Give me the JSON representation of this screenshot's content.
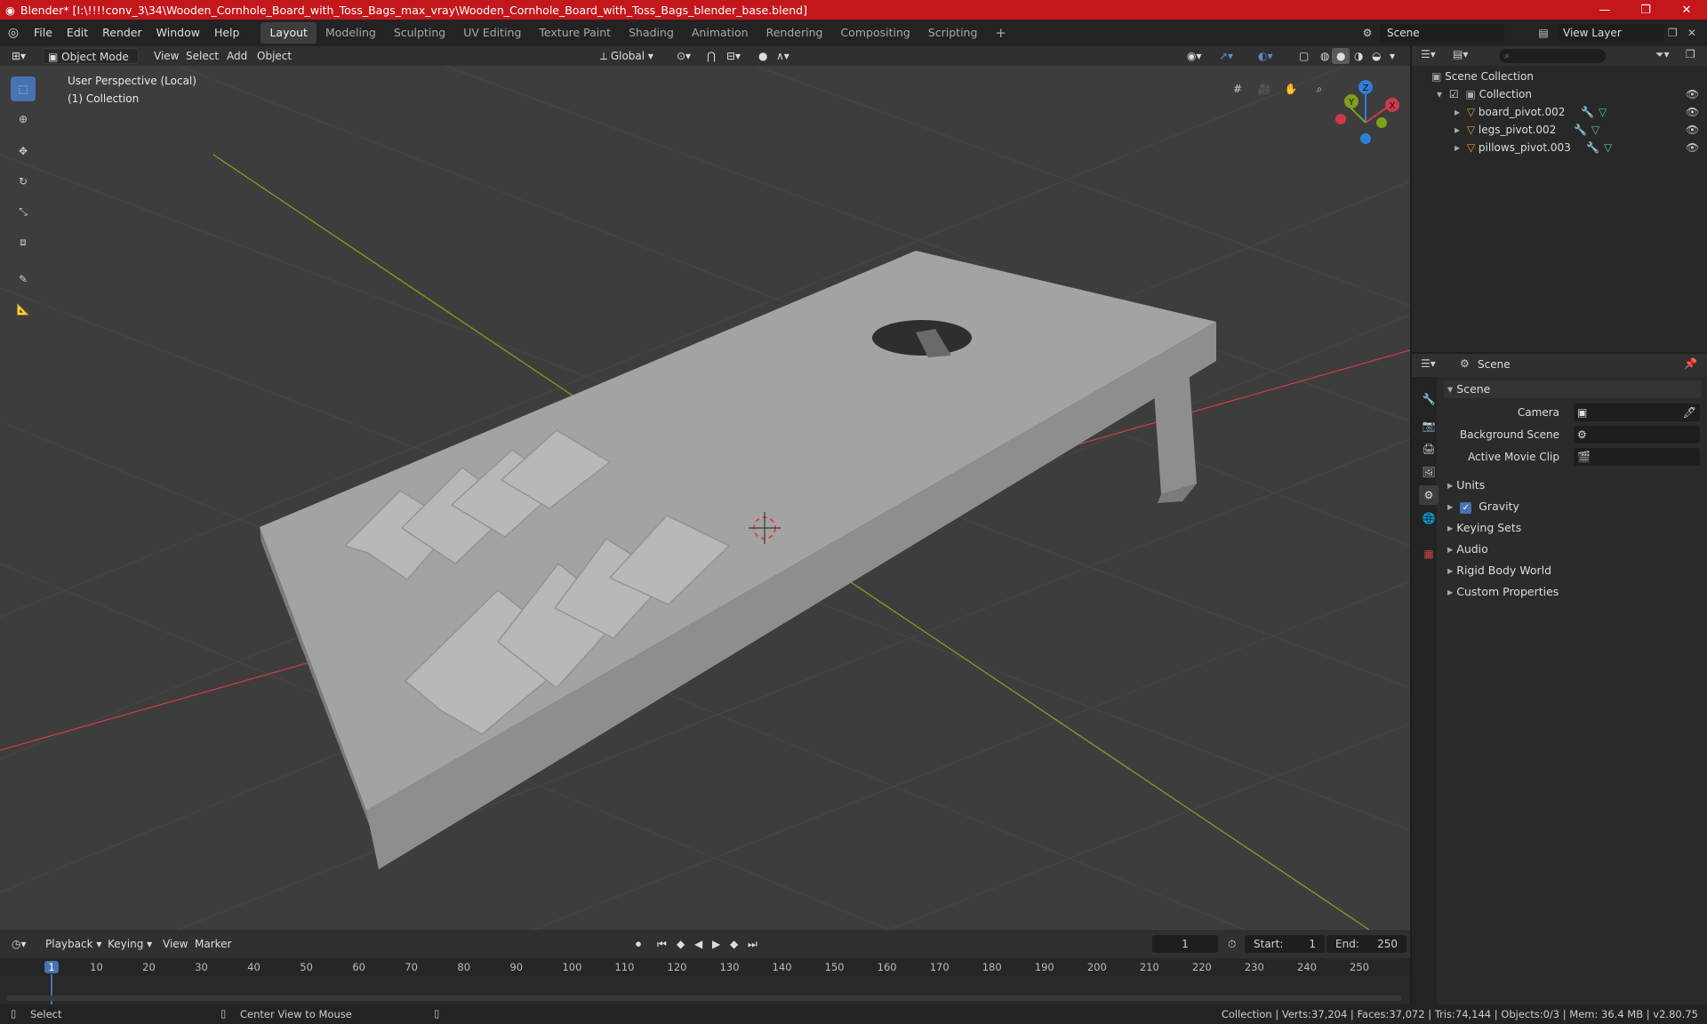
{
  "window": {
    "title": "Blender* [I:\\!!!!conv_3\\34\\Wooden_Cornhole_Board_with_Toss_Bags_max_vray\\Wooden_Cornhole_Board_with_Toss_Bags_blender_base.blend]",
    "minimize": "—",
    "maximize": "❐",
    "close": "✕"
  },
  "menu": [
    "File",
    "Edit",
    "Render",
    "Window",
    "Help"
  ],
  "workspaces": [
    "Layout",
    "Modeling",
    "Sculpting",
    "UV Editing",
    "Texture Paint",
    "Shading",
    "Animation",
    "Rendering",
    "Compositing",
    "Scripting"
  ],
  "workspace_add": "+",
  "scene_selector": {
    "value": "Scene"
  },
  "view_layer_selector": {
    "value": "View Layer"
  },
  "viewport_header": {
    "mode": "Object Mode",
    "menus": [
      "View",
      "Select",
      "Add",
      "Object"
    ],
    "orientation": "Global"
  },
  "viewport_overlay": {
    "perspective": "User Perspective (Local)",
    "collection": "(1) Collection"
  },
  "gizmo": {
    "x": "X",
    "y": "Y",
    "z": "Z"
  },
  "outliner": {
    "root": "Scene Collection",
    "collection": "Collection",
    "items": [
      "board_pivot.002",
      "legs_pivot.002",
      "pillows_pivot.003"
    ]
  },
  "properties": {
    "header": "Scene",
    "section": "Scene",
    "fields": [
      {
        "label": "Camera",
        "value": ""
      },
      {
        "label": "Background Scene",
        "value": ""
      },
      {
        "label": "Active Movie Clip",
        "value": ""
      }
    ],
    "panels": [
      {
        "label": "Units"
      },
      {
        "label": "Gravity",
        "checkbox": true
      },
      {
        "label": "Keying Sets"
      },
      {
        "label": "Audio"
      },
      {
        "label": "Rigid Body World"
      },
      {
        "label": "Custom Properties"
      }
    ]
  },
  "timeline": {
    "menus": [
      "Playback",
      "Keying",
      "View",
      "Marker"
    ],
    "current_frame": "1",
    "start_label": "Start:",
    "start": "1",
    "end_label": "End:",
    "end": "250",
    "ticks": [
      "1",
      "10",
      "20",
      "30",
      "40",
      "50",
      "60",
      "70",
      "80",
      "90",
      "100",
      "110",
      "120",
      "130",
      "140",
      "150",
      "160",
      "170",
      "180",
      "190",
      "200",
      "210",
      "220",
      "230",
      "240",
      "250"
    ]
  },
  "statusbar": {
    "left": "Select",
    "middle": "Center View to Mouse",
    "stats": "Collection | Verts:37,204 | Faces:37,072 | Tris:74,144 | Objects:0/3 | Mem: 36.4 MB | v2.80.75"
  },
  "colors": {
    "accent": "#4772b3",
    "title_bar": "#c4171c",
    "axis_x": "#cc3a4a",
    "axis_y": "#7ea01c",
    "gizmo_z": "#2e7fd8"
  }
}
